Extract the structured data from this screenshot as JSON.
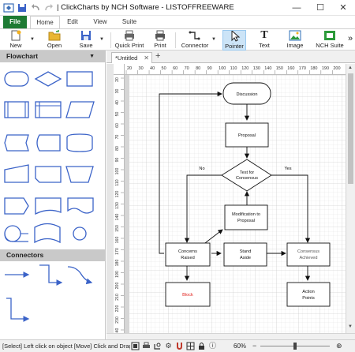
{
  "titlebar": {
    "title": "| ClickCharts by NCH Software - LISTOFFREEWARE",
    "minimize": "—",
    "maximize": "☐",
    "close": "✕"
  },
  "ribbon_tabs": [
    "File",
    "Home",
    "Edit",
    "View",
    "Suite"
  ],
  "toolbar": {
    "new": "New",
    "open": "Open",
    "save": "Save",
    "quick_print": "Quick Print",
    "print": "Print",
    "connector": "Connector",
    "pointer": "Pointer",
    "text": "Text",
    "image": "Image",
    "nch_suite": "NCH Suite",
    "more": "»"
  },
  "panels": {
    "flowchart_title": "Flowchart",
    "connectors_title": "Connectors"
  },
  "document": {
    "tab_label": "*Untitled",
    "close": "✕",
    "add": "+"
  },
  "rulers": {
    "horizontal": [
      "20",
      "30",
      "40",
      "50",
      "60",
      "70",
      "80",
      "90",
      "100",
      "110",
      "120",
      "130",
      "140",
      "150",
      "160",
      "170",
      "180",
      "190",
      "200"
    ],
    "vertical": [
      "20",
      "30",
      "40",
      "50",
      "60",
      "70",
      "80",
      "90",
      "100",
      "110",
      "120",
      "130",
      "140",
      "150",
      "160",
      "170",
      "180",
      "190",
      "200",
      "210",
      "220",
      "230",
      "240"
    ]
  },
  "diagram": {
    "discussion": "Discussion",
    "proposal": "Proposal",
    "decision_line1": "Test for",
    "decision_line2": "Consensus",
    "no_label": "No",
    "yes_label": "Yes",
    "modification_line1": "Modification to",
    "modification_line2": "Proposal",
    "concerns_line1": "Concerns",
    "concerns_line2": "Raised",
    "stand_aside_line1": "Stand",
    "stand_aside_line2": "Aside",
    "consensus_line1": "Consensus",
    "consensus_line2": "Achieved",
    "block": "Block",
    "action_line1": "Action",
    "action_line2": "Points",
    "block_color": "#e0201b",
    "consensus_text_color": "#555555"
  },
  "statusbar": {
    "text": "[Select] Left click on object  [Move] Click and Drag",
    "zoom": "60%",
    "zoom_out": "−",
    "zoom_in": "⊕"
  },
  "colors": {
    "file_tab": "#1e7b34",
    "shape_stroke": "#3b63c8",
    "panel_header": "#c9c9c9",
    "active_tool": "#cce4f7"
  }
}
